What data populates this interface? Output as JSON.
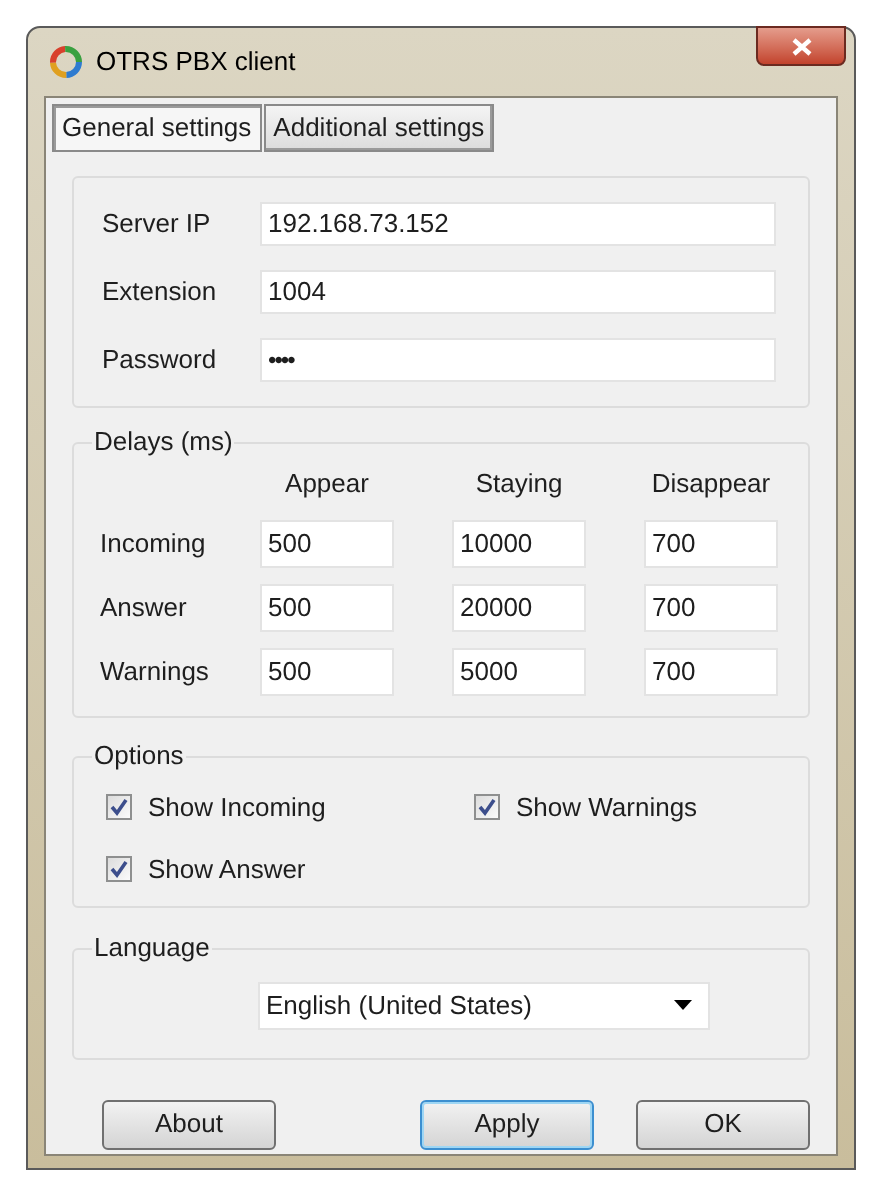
{
  "window": {
    "title": "OTRS PBX client"
  },
  "tabs": [
    {
      "label": "General settings",
      "selected": true
    },
    {
      "label": "Additional settings",
      "selected": false
    }
  ],
  "connection": {
    "fields": [
      {
        "label": "Server IP",
        "value": "192.168.73.152",
        "kind": "text"
      },
      {
        "label": "Extension",
        "value": "1004",
        "kind": "text"
      },
      {
        "label": "Password",
        "value": "••••",
        "kind": "password"
      }
    ]
  },
  "delays": {
    "title": "Delays (ms)",
    "columns": [
      "Appear",
      "Staying",
      "Disappear"
    ],
    "rows": [
      {
        "label": "Incoming",
        "values": [
          "500",
          "10000",
          "700"
        ]
      },
      {
        "label": "Answer",
        "values": [
          "500",
          "20000",
          "700"
        ]
      },
      {
        "label": "Warnings",
        "values": [
          "500",
          "5000",
          "700"
        ]
      }
    ]
  },
  "options": {
    "title": "Options",
    "items": [
      {
        "label": "Show Incoming",
        "checked": true
      },
      {
        "label": "Show Warnings",
        "checked": true
      },
      {
        "label": "Show Answer",
        "checked": true
      }
    ]
  },
  "language": {
    "title": "Language",
    "value": "English (United States)"
  },
  "buttons": [
    {
      "label": "About",
      "focused": false
    },
    {
      "label": "Apply",
      "focused": true
    },
    {
      "label": "OK",
      "focused": false
    }
  ]
}
